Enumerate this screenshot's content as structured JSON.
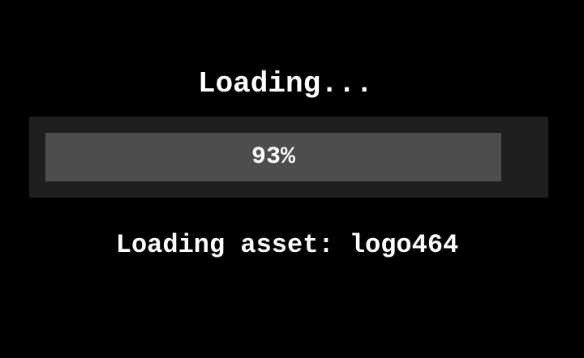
{
  "loading_screen": {
    "title": "Loading...",
    "progress": {
      "fraction": 0.93,
      "label": "93%"
    },
    "status_text": "Loading asset: logo464"
  },
  "colors": {
    "background": "#000000",
    "track": "#1f1f1f",
    "fill": "#4d4d4d",
    "text": "#ffffff"
  }
}
